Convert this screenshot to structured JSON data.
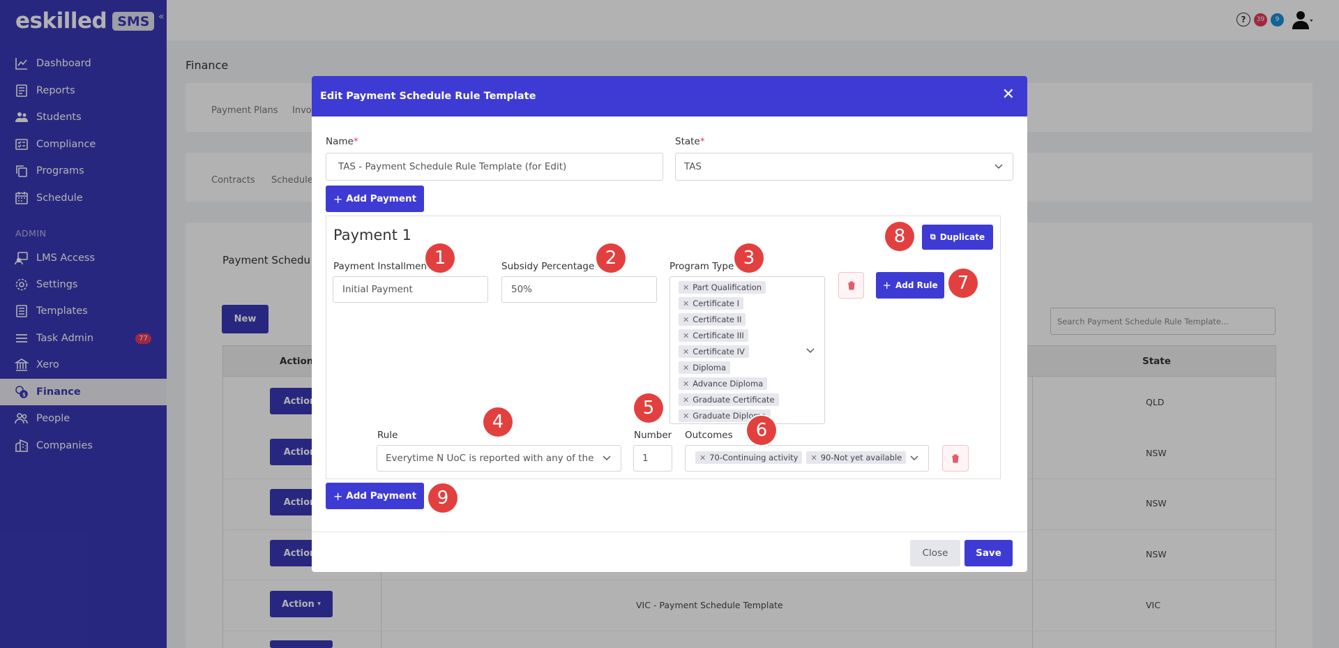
{
  "app": {
    "logo_text": "eskilled",
    "logo_badge": "SMS"
  },
  "sidebar": {
    "items": [
      {
        "label": "Dashboard",
        "icon": "chart-line-icon"
      },
      {
        "label": "Reports",
        "icon": "report-icon"
      },
      {
        "label": "Students",
        "icon": "users-icon"
      },
      {
        "label": "Compliance",
        "icon": "checklist-icon"
      },
      {
        "label": "Programs",
        "icon": "copy-icon"
      },
      {
        "label": "Schedule",
        "icon": "calendar-icon"
      }
    ],
    "section_admin": "ADMIN",
    "admin_items": [
      {
        "label": "LMS Access",
        "icon": "lms-icon"
      },
      {
        "label": "Settings",
        "icon": "gear-icon"
      },
      {
        "label": "Templates",
        "icon": "template-icon"
      },
      {
        "label": "Task Admin",
        "icon": "task-icon",
        "badge": "77"
      },
      {
        "label": "Xero",
        "icon": "bank-icon"
      },
      {
        "label": "Finance",
        "icon": "coins-icon",
        "active": true
      },
      {
        "label": "People",
        "icon": "people-icon"
      },
      {
        "label": "Companies",
        "icon": "building-icon"
      }
    ]
  },
  "topbar": {
    "notif_red": "39",
    "notif_blue": "9"
  },
  "page": {
    "title": "Finance",
    "tabs_row1": [
      "Payment Plans",
      "Invo"
    ],
    "tabs_row2": [
      "Contracts",
      "Schedule"
    ],
    "section_title": "Payment Schedu",
    "new_label": "New",
    "search_placeholder": "Search Payment Schedule Rule Template...",
    "table": {
      "col_actions": "Actions",
      "col_state": "State",
      "action_label": "Action",
      "rows": [
        {
          "name": "",
          "state": "QLD"
        },
        {
          "name": "",
          "state": "NSW"
        },
        {
          "name": "",
          "state": "NSW"
        },
        {
          "name": "",
          "state": "NSW"
        },
        {
          "name": "VIC - Payment Schedule Template",
          "state": "VIC"
        }
      ]
    }
  },
  "modal": {
    "title": "Edit Payment Schedule Rule Template",
    "name_label": "Name",
    "name_value": "TAS - Payment Schedule Rule Template (for Edit)",
    "state_label": "State",
    "state_value": "TAS",
    "add_payment_label": "Add Payment",
    "payment": {
      "title": "Payment 1",
      "duplicate_label": "Duplicate",
      "installment_label": "Payment Installment",
      "installment_value": "Initial Payment",
      "subsidy_label": "Subsidy Percentage",
      "subsidy_value": "50%",
      "program_type_label": "Program Type",
      "program_types": [
        "Part Qualification",
        "Certificate I",
        "Certificate II",
        "Certificate III",
        "Certificate IV",
        "Diploma",
        "Advance Diploma",
        "Graduate Certificate",
        "Graduate Diploma"
      ],
      "add_rule_label": "Add Rule",
      "rule_label": "Rule",
      "rule_value": "Everytime N UoC is reported with any of the foll",
      "number_label": "Number",
      "number_value": "1",
      "outcomes_label": "Outcomes",
      "outcomes": [
        "70-Continuing activity",
        "90-Not yet available"
      ]
    },
    "close_label": "Close",
    "save_label": "Save"
  },
  "annotations": [
    "1",
    "2",
    "3",
    "4",
    "5",
    "6",
    "7",
    "8",
    "9"
  ],
  "colors": {
    "sidebar": "#3a39b8",
    "primary": "#3e3bd4",
    "badge_red": "#e2403f"
  }
}
